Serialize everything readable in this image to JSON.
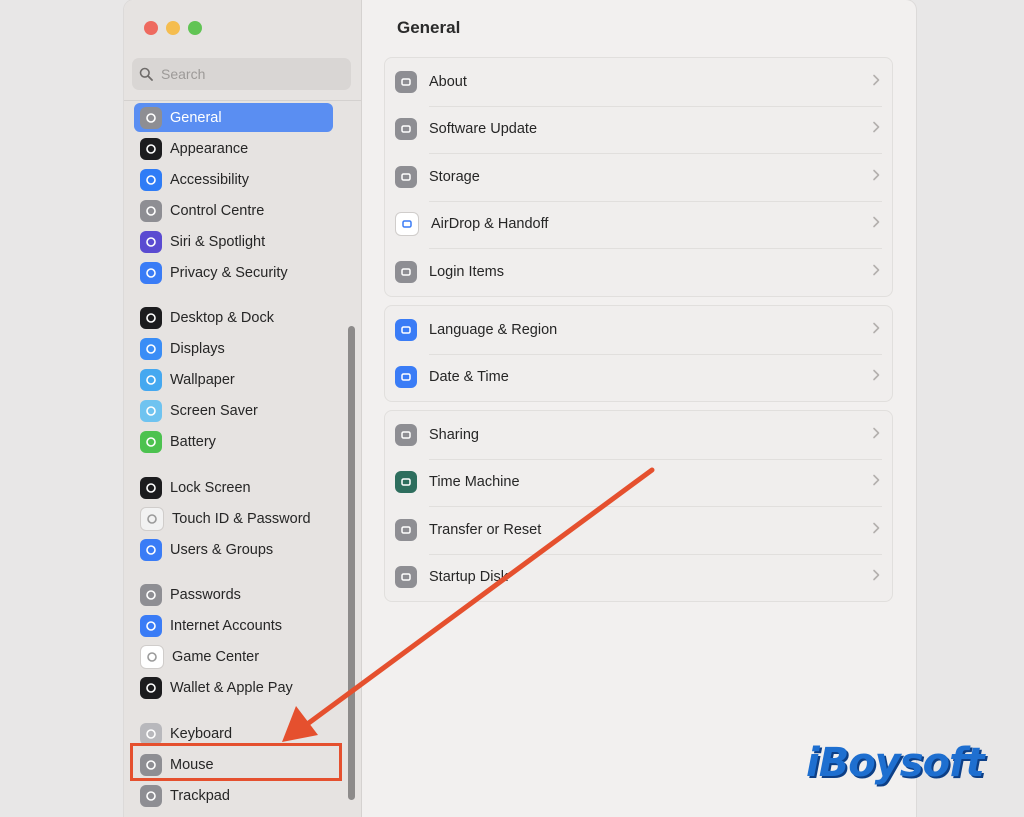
{
  "window": {
    "controls": [
      "close",
      "minimize",
      "zoom"
    ]
  },
  "search": {
    "placeholder": "Search"
  },
  "sidebar": {
    "items": [
      {
        "label": "General",
        "icon": "gear-icon",
        "color": "#8e8e93",
        "selected": true
      },
      {
        "label": "Appearance",
        "icon": "appearance-icon",
        "color": "#1c1c1e"
      },
      {
        "label": "Accessibility",
        "icon": "accessibility-icon",
        "color": "#2f7cf6"
      },
      {
        "label": "Control Centre",
        "icon": "control-centre-icon",
        "color": "#8e8e93"
      },
      {
        "label": "Siri & Spotlight",
        "icon": "siri-icon",
        "color": "#5b4bd1"
      },
      {
        "label": "Privacy & Security",
        "icon": "hand-icon",
        "color": "#3a7cf6"
      },
      {
        "label": "Desktop & Dock",
        "icon": "dock-icon",
        "color": "#1c1c1e"
      },
      {
        "label": "Displays",
        "icon": "sun-icon",
        "color": "#3a8df6"
      },
      {
        "label": "Wallpaper",
        "icon": "flower-icon",
        "color": "#45a8f0"
      },
      {
        "label": "Screen Saver",
        "icon": "screen-saver-icon",
        "color": "#6fc3f0"
      },
      {
        "label": "Battery",
        "icon": "battery-icon",
        "color": "#4cc24f"
      },
      {
        "label": "Lock Screen",
        "icon": "lock-icon",
        "color": "#1c1c1e"
      },
      {
        "label": "Touch ID & Password",
        "icon": "fingerprint-icon",
        "color": "#f2f2f2"
      },
      {
        "label": "Users & Groups",
        "icon": "users-icon",
        "color": "#3a7cf6"
      },
      {
        "label": "Passwords",
        "icon": "key-icon",
        "color": "#8e8e93"
      },
      {
        "label": "Internet Accounts",
        "icon": "at-icon",
        "color": "#3a7cf6"
      },
      {
        "label": "Game Center",
        "icon": "game-center-icon",
        "color": "#ffffff"
      },
      {
        "label": "Wallet & Apple Pay",
        "icon": "wallet-icon",
        "color": "#1c1c1e"
      },
      {
        "label": "Keyboard",
        "icon": "keyboard-icon",
        "color": "#b8b8bc"
      },
      {
        "label": "Mouse",
        "icon": "mouse-icon",
        "color": "#8e8e93"
      },
      {
        "label": "Trackpad",
        "icon": "trackpad-icon",
        "color": "#8e8e93"
      }
    ]
  },
  "main": {
    "title": "General",
    "groups": [
      [
        {
          "label": "About",
          "icon": "laptop-icon",
          "color": "#8e8e93"
        },
        {
          "label": "Software Update",
          "icon": "software-update-icon",
          "color": "#8e8e93"
        },
        {
          "label": "Storage",
          "icon": "storage-icon",
          "color": "#8e8e93"
        },
        {
          "label": "AirDrop & Handoff",
          "icon": "airdrop-icon",
          "color": "#ffffff"
        },
        {
          "label": "Login Items",
          "icon": "list-icon",
          "color": "#8e8e93"
        }
      ],
      [
        {
          "label": "Language & Region",
          "icon": "globe-icon",
          "color": "#3a7cf6"
        },
        {
          "label": "Date & Time",
          "icon": "calendar-clock-icon",
          "color": "#3a7cf6"
        }
      ],
      [
        {
          "label": "Sharing",
          "icon": "sharing-icon",
          "color": "#8e8e93"
        },
        {
          "label": "Time Machine",
          "icon": "time-machine-icon",
          "color": "#2e6e5e"
        },
        {
          "label": "Transfer or Reset",
          "icon": "reset-icon",
          "color": "#8e8e93"
        },
        {
          "label": "Startup Disk",
          "icon": "disk-icon",
          "color": "#8e8e93"
        }
      ]
    ]
  },
  "annotation": {
    "arrow_color": "#e5502e",
    "highlighted_item": "Mouse"
  },
  "watermark": {
    "text": "iBoysoft"
  }
}
